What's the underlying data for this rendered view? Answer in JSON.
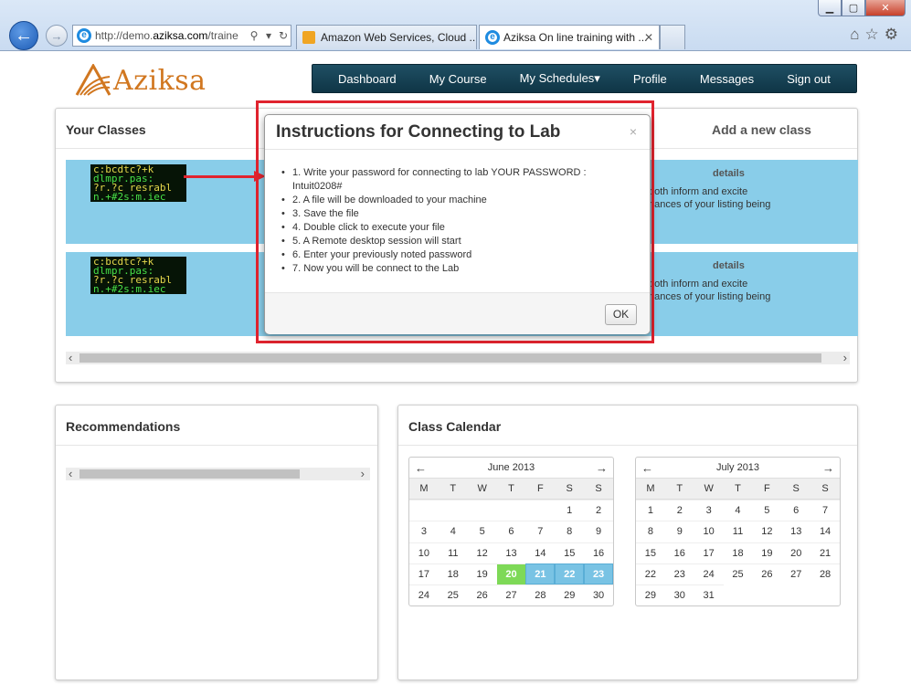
{
  "browser": {
    "address": "http://demo.aziksa.com/traine",
    "address_prefix": "http://demo.",
    "address_domain": "aziksa.com",
    "address_suffix": "/traine",
    "tabs": [
      {
        "label": "Amazon Web Services, Cloud ..."
      },
      {
        "label": "Aziksa On line training with ..."
      }
    ]
  },
  "site": {
    "logo_text": "Aziksa",
    "brand_color": "#d17720",
    "nav": [
      "Dashboard",
      "My Course",
      "My Schedules▾",
      "Profile",
      "Messages",
      "Sign out"
    ]
  },
  "classes_panel": {
    "title": "Your Classes",
    "add_link": "Add a new class",
    "cards": [
      {
        "details": "details",
        "desc": "both inform and excite\nhances of your listing being"
      },
      {
        "details": "details",
        "desc": "both inform and excite\nhances of your listing being"
      }
    ]
  },
  "modal": {
    "title": "Instructions for Connecting to Lab",
    "close": "×",
    "steps": [
      "1. Write your password for connecting to lab YOUR PASSWORD : Intuit0208#",
      "2. A file will be downloaded to your machine",
      "3. Save the file",
      "4. Double click to execute your file",
      "5. A Remote desktop session will start",
      "6. Enter your previously noted password",
      "7. Now you will be connect to the Lab"
    ],
    "ok": "OK",
    "highlight_color": "#e0232e"
  },
  "recommendations": {
    "title": "Recommendations"
  },
  "calendar": {
    "title": "Class Calendar",
    "dow": [
      "M",
      "T",
      "W",
      "T",
      "F",
      "S",
      "S"
    ],
    "months": [
      {
        "name": "June 2013",
        "days": [
          "",
          "",
          "",
          "",
          "",
          "1",
          "2",
          "3",
          "4",
          "5",
          "6",
          "7",
          "8",
          "9",
          "10",
          "11",
          "12",
          "13",
          "14",
          "15",
          "16",
          "17",
          "18",
          "19",
          "20",
          "21",
          "22",
          "23",
          "24",
          "25",
          "26",
          "27",
          "28",
          "29",
          "30"
        ],
        "green": [
          "20"
        ],
        "blue": [
          "21",
          "22",
          "23"
        ]
      },
      {
        "name": "July 2013",
        "days": [
          "1",
          "2",
          "3",
          "4",
          "5",
          "6",
          "7",
          "8",
          "9",
          "10",
          "11",
          "12",
          "13",
          "14",
          "15",
          "16",
          "17",
          "18",
          "19",
          "20",
          "21",
          "22",
          "23",
          "24",
          "25",
          "26",
          "27",
          "28",
          "29",
          "30",
          "31"
        ],
        "green": [],
        "blue": []
      }
    ]
  }
}
